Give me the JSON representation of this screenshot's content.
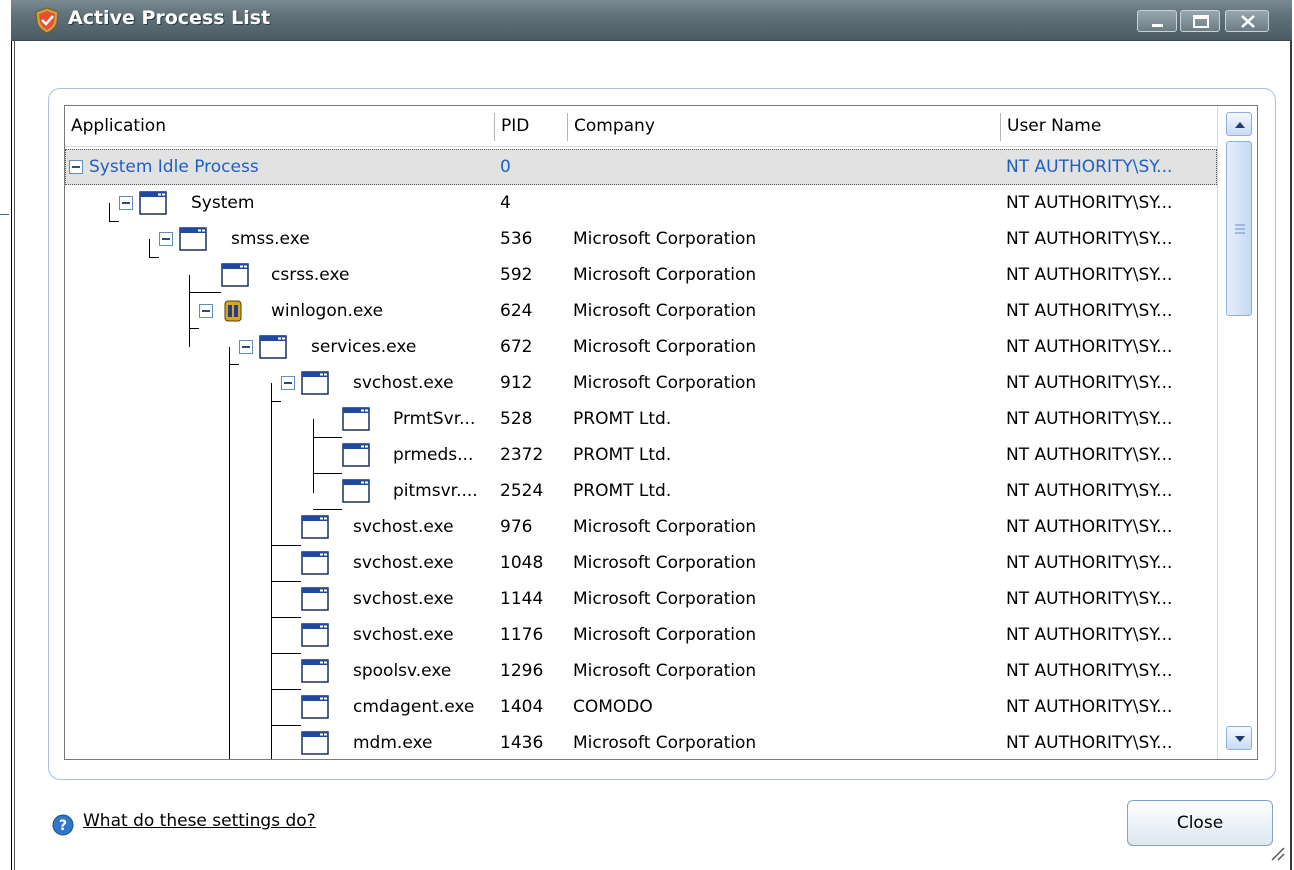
{
  "window": {
    "title": "Active Process List",
    "title_icon": "comodo-shield-icon",
    "buttons": [
      "minimize-icon",
      "maximize-icon",
      "close-icon"
    ]
  },
  "columns": {
    "application": "Application",
    "pid": "PID",
    "company": "Company",
    "user": "User Name"
  },
  "processes": [
    {
      "name": "System Idle Process",
      "pid": "0",
      "company": "",
      "user": "NT AUTHORITY\\SY...",
      "icon": "none",
      "selected": true
    },
    {
      "name": "System",
      "pid": "4",
      "company": "",
      "user": "NT AUTHORITY\\SY...",
      "icon": "window-icon"
    },
    {
      "name": "smss.exe",
      "pid": "536",
      "company": "Microsoft Corporation",
      "user": "NT AUTHORITY\\SY...",
      "icon": "window-icon"
    },
    {
      "name": "csrss.exe",
      "pid": "592",
      "company": "Microsoft Corporation",
      "user": "NT AUTHORITY\\SY...",
      "icon": "window-icon"
    },
    {
      "name": "winlogon.exe",
      "pid": "624",
      "company": "Microsoft Corporation",
      "user": "NT AUTHORITY\\SY...",
      "icon": "winlogon-icon"
    },
    {
      "name": "services.exe",
      "pid": "672",
      "company": "Microsoft Corporation",
      "user": "NT AUTHORITY\\SY...",
      "icon": "window-icon"
    },
    {
      "name": "svchost.exe",
      "pid": "912",
      "company": "Microsoft Corporation",
      "user": "NT AUTHORITY\\SY...",
      "icon": "window-icon"
    },
    {
      "name": "PrmtSvr...",
      "pid": "528",
      "company": "PROMT Ltd.",
      "user": "NT AUTHORITY\\SY...",
      "icon": "window-icon"
    },
    {
      "name": "prmeds...",
      "pid": "2372",
      "company": "PROMT Ltd.",
      "user": "NT AUTHORITY\\SY...",
      "icon": "window-icon"
    },
    {
      "name": "pitmsvr....",
      "pid": "2524",
      "company": "PROMT Ltd.",
      "user": "NT AUTHORITY\\SY...",
      "icon": "window-icon"
    },
    {
      "name": "svchost.exe",
      "pid": "976",
      "company": "Microsoft Corporation",
      "user": "NT AUTHORITY\\SY...",
      "icon": "window-icon"
    },
    {
      "name": "svchost.exe",
      "pid": "1048",
      "company": "Microsoft Corporation",
      "user": "NT AUTHORITY\\SY...",
      "icon": "window-icon"
    },
    {
      "name": "svchost.exe",
      "pid": "1144",
      "company": "Microsoft Corporation",
      "user": "NT AUTHORITY\\SY...",
      "icon": "window-icon"
    },
    {
      "name": "svchost.exe",
      "pid": "1176",
      "company": "Microsoft Corporation",
      "user": "NT AUTHORITY\\SY...",
      "icon": "window-icon"
    },
    {
      "name": "spoolsv.exe",
      "pid": "1296",
      "company": "Microsoft Corporation",
      "user": "NT AUTHORITY\\SY...",
      "icon": "window-icon"
    },
    {
      "name": "cmdagent.exe",
      "pid": "1404",
      "company": "COMODO",
      "user": "NT AUTHORITY\\SY...",
      "icon": "window-icon"
    },
    {
      "name": "mdm.exe",
      "pid": "1436",
      "company": "Microsoft Corporation",
      "user": "NT AUTHORITY\\SY...",
      "icon": "window-icon"
    }
  ],
  "footer": {
    "help_link": "What do these settings do?",
    "help_icon": "help-question-icon",
    "close_label": "Close"
  },
  "colors": {
    "titlebar": "#5f7079",
    "selected_text": "#1f5fc4",
    "selected_bg": "#e2e2e2"
  }
}
